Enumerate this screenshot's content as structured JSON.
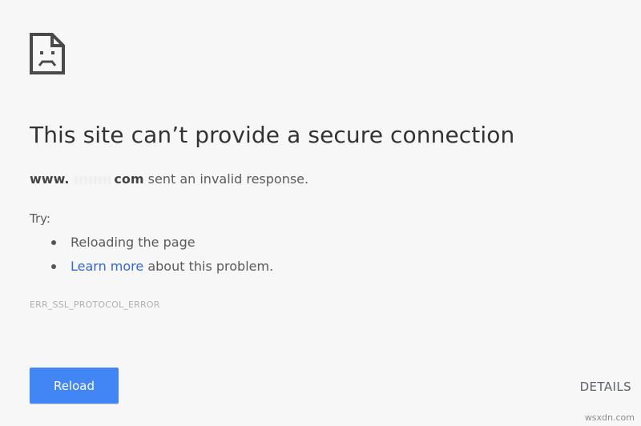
{
  "icons": {
    "error": "sad-page-icon",
    "bullet": "bullet-icon"
  },
  "colors": {
    "background": "#f7f7f7",
    "accent": "#4285f4",
    "link": "#3367d6",
    "text": "#333333"
  },
  "error_page": {
    "title": "This site can’t provide a secure connection",
    "message": {
      "domain_prefix": "www.",
      "domain_suffix": "com",
      "text": " sent an invalid response."
    },
    "try_label": "Try:",
    "suggestions": {
      "reload_text": "Reloading the page",
      "learn_more_link": "Learn more",
      "learn_more_rest": " about this problem."
    },
    "error_code": "ERR_SSL_PROTOCOL_ERROR",
    "reload_button": "Reload",
    "details_button": "DETAILS"
  },
  "watermark": "wsxdn.com"
}
